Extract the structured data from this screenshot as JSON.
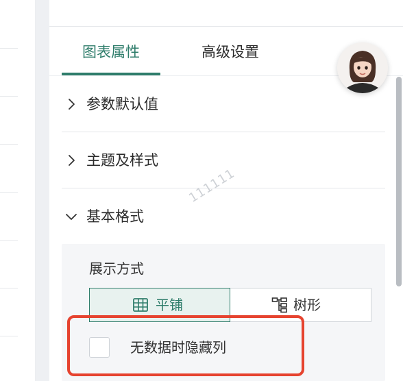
{
  "tabs": [
    {
      "label": "图表属性",
      "active": true
    },
    {
      "label": "高级设置",
      "active": false
    }
  ],
  "accordion": [
    {
      "label": "参数默认值",
      "expanded": false
    },
    {
      "label": "主题及样式",
      "expanded": false
    },
    {
      "label": "基本格式",
      "expanded": true
    }
  ],
  "watermark": "111111",
  "basic_format": {
    "display_mode_title": "展示方式",
    "options": [
      {
        "label": "平铺",
        "icon": "table-grid-icon",
        "selected": true
      },
      {
        "label": "树形",
        "icon": "tree-structure-icon",
        "selected": false
      }
    ],
    "hide_empty_columns": {
      "label": "无数据时隐藏列",
      "checked": false
    }
  },
  "colors": {
    "accent": "#2f7d6b",
    "highlight": "#e6432f"
  }
}
